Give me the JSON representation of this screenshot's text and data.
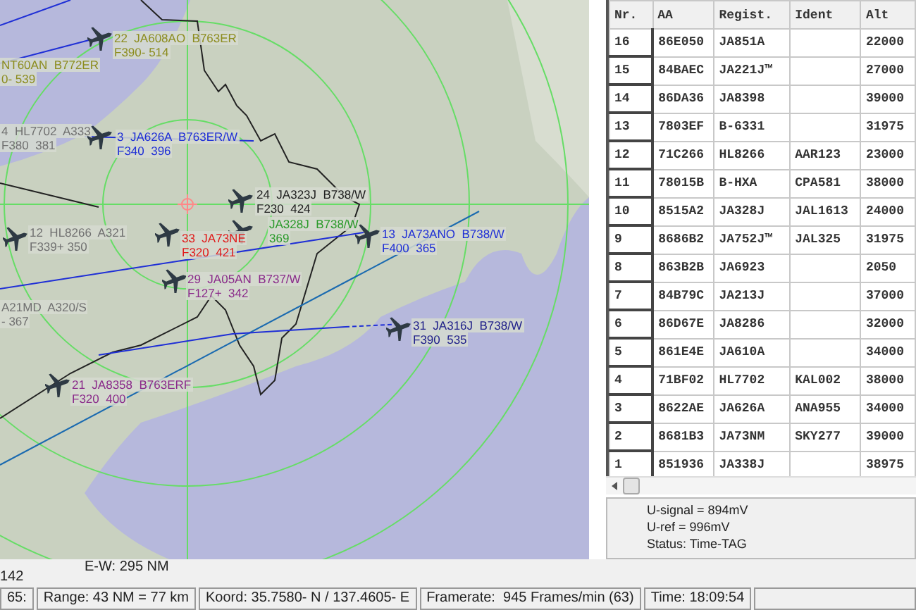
{
  "map": {
    "aircraft": [
      {
        "line1": "22  JA608AO  B763ER",
        "line2": "F390- 514",
        "color": "#8c8c1e"
      },
      {
        "line1": "NT60AN  B772ER",
        "line2": "0- 539",
        "color": "#8c8c1e"
      },
      {
        "line1": "4  HL7702  A333",
        "line2": "F380  381",
        "color": "#707070"
      },
      {
        "line1": "3  JA626A  B763ER/W",
        "line2": "F340  396",
        "color": "#1f2fd6"
      },
      {
        "line1": "24  JA323J  B738/W",
        "line2": "F230  424",
        "color": "#202020"
      },
      {
        "line1": "12  HL8266  A321",
        "line2": "F339+ 350",
        "color": "#707070"
      },
      {
        "line1": "JA328J  B738/W",
        "line2": "369",
        "color": "#2a9a2a"
      },
      {
        "line1": "33  JA73NE",
        "line2": "F320  421",
        "color": "#e01818"
      },
      {
        "line1": "29  JA05AN  B737/W",
        "line2": "F127+  342",
        "color": "#8a2a8a"
      },
      {
        "line1": "A21MD  A320/S",
        "line2": "- 367",
        "color": "#707070"
      },
      {
        "line1": "13  JA73ANO  B738/W",
        "line2": "F400  365",
        "color": "#1f2fd6"
      },
      {
        "line1": "31  JA316J  B738/W",
        "line2": "F390  535",
        "color": "#20208a"
      },
      {
        "line1": "21  JA8358  B763ERF",
        "line2": "F320  400",
        "color": "#8a2a8a"
      }
    ]
  },
  "below_map": {
    "left_value": "142",
    "ew": "E-W: 295 NM"
  },
  "table": {
    "columns": [
      "Nr.",
      "AA",
      "Regist.",
      "Ident",
      "Alt"
    ],
    "rows": [
      {
        "nr": "16",
        "aa": "86E050",
        "regist": "JA851A",
        "alt": "22000"
      },
      {
        "nr": "15",
        "aa": "84BAEC",
        "regist": "JA221J™",
        "alt": "27000"
      },
      {
        "nr": "14",
        "aa": "86DA36",
        "regist": "JA8398",
        "alt": "39000"
      },
      {
        "nr": "13",
        "aa": "7803EF",
        "regist": "B-6331",
        "alt": "31975"
      },
      {
        "nr": "12",
        "aa": "71C266",
        "regist": "HL8266",
        "ident": "AAR123",
        "alt": "23000"
      },
      {
        "nr": "11",
        "aa": "78015B",
        "regist": "B-HXA",
        "ident": "CPA581",
        "alt": "38000"
      },
      {
        "nr": "10",
        "aa": "8515A2",
        "regist": "JA328J",
        "ident": "JAL1613",
        "alt": "24000"
      },
      {
        "nr": "9",
        "aa": "8686B2",
        "regist": "JA752J™",
        "ident": "JAL325",
        "alt": "31975"
      },
      {
        "nr": "8",
        "aa": "863B2B",
        "regist": "JA6923",
        "alt": "2050"
      },
      {
        "nr": "7",
        "aa": "84B79C",
        "regist": "JA213J",
        "alt": "37000"
      },
      {
        "nr": "6",
        "aa": "86D67E",
        "regist": "JA8286",
        "alt": "32000"
      },
      {
        "nr": "5",
        "aa": "861E4E",
        "regist": "JA610A",
        "alt": "34000"
      },
      {
        "nr": "4",
        "aa": "71BF02",
        "regist": "HL7702",
        "ident": "KAL002",
        "alt": "38000"
      },
      {
        "nr": "3",
        "aa": "8622AE",
        "regist": "JA626A",
        "ident": "ANA955",
        "alt": "34000"
      },
      {
        "nr": "2",
        "aa": "8681B3",
        "regist": "JA73NM",
        "ident": "SKY277",
        "alt": "39000"
      },
      {
        "nr": "1",
        "aa": "851936",
        "regist": "JA338J",
        "alt": "38975"
      }
    ]
  },
  "info": [
    "U-signal = 894mV",
    "U-ref = 996mV",
    "Status: Time-TAG"
  ],
  "status_bar": [
    "65:",
    "Range: 43 NM = 77 km",
    "Koord: 35.7580- N / 137.4605- E",
    "Framerate:  945 Frames/min (63)",
    "Time: 18:09:54"
  ]
}
